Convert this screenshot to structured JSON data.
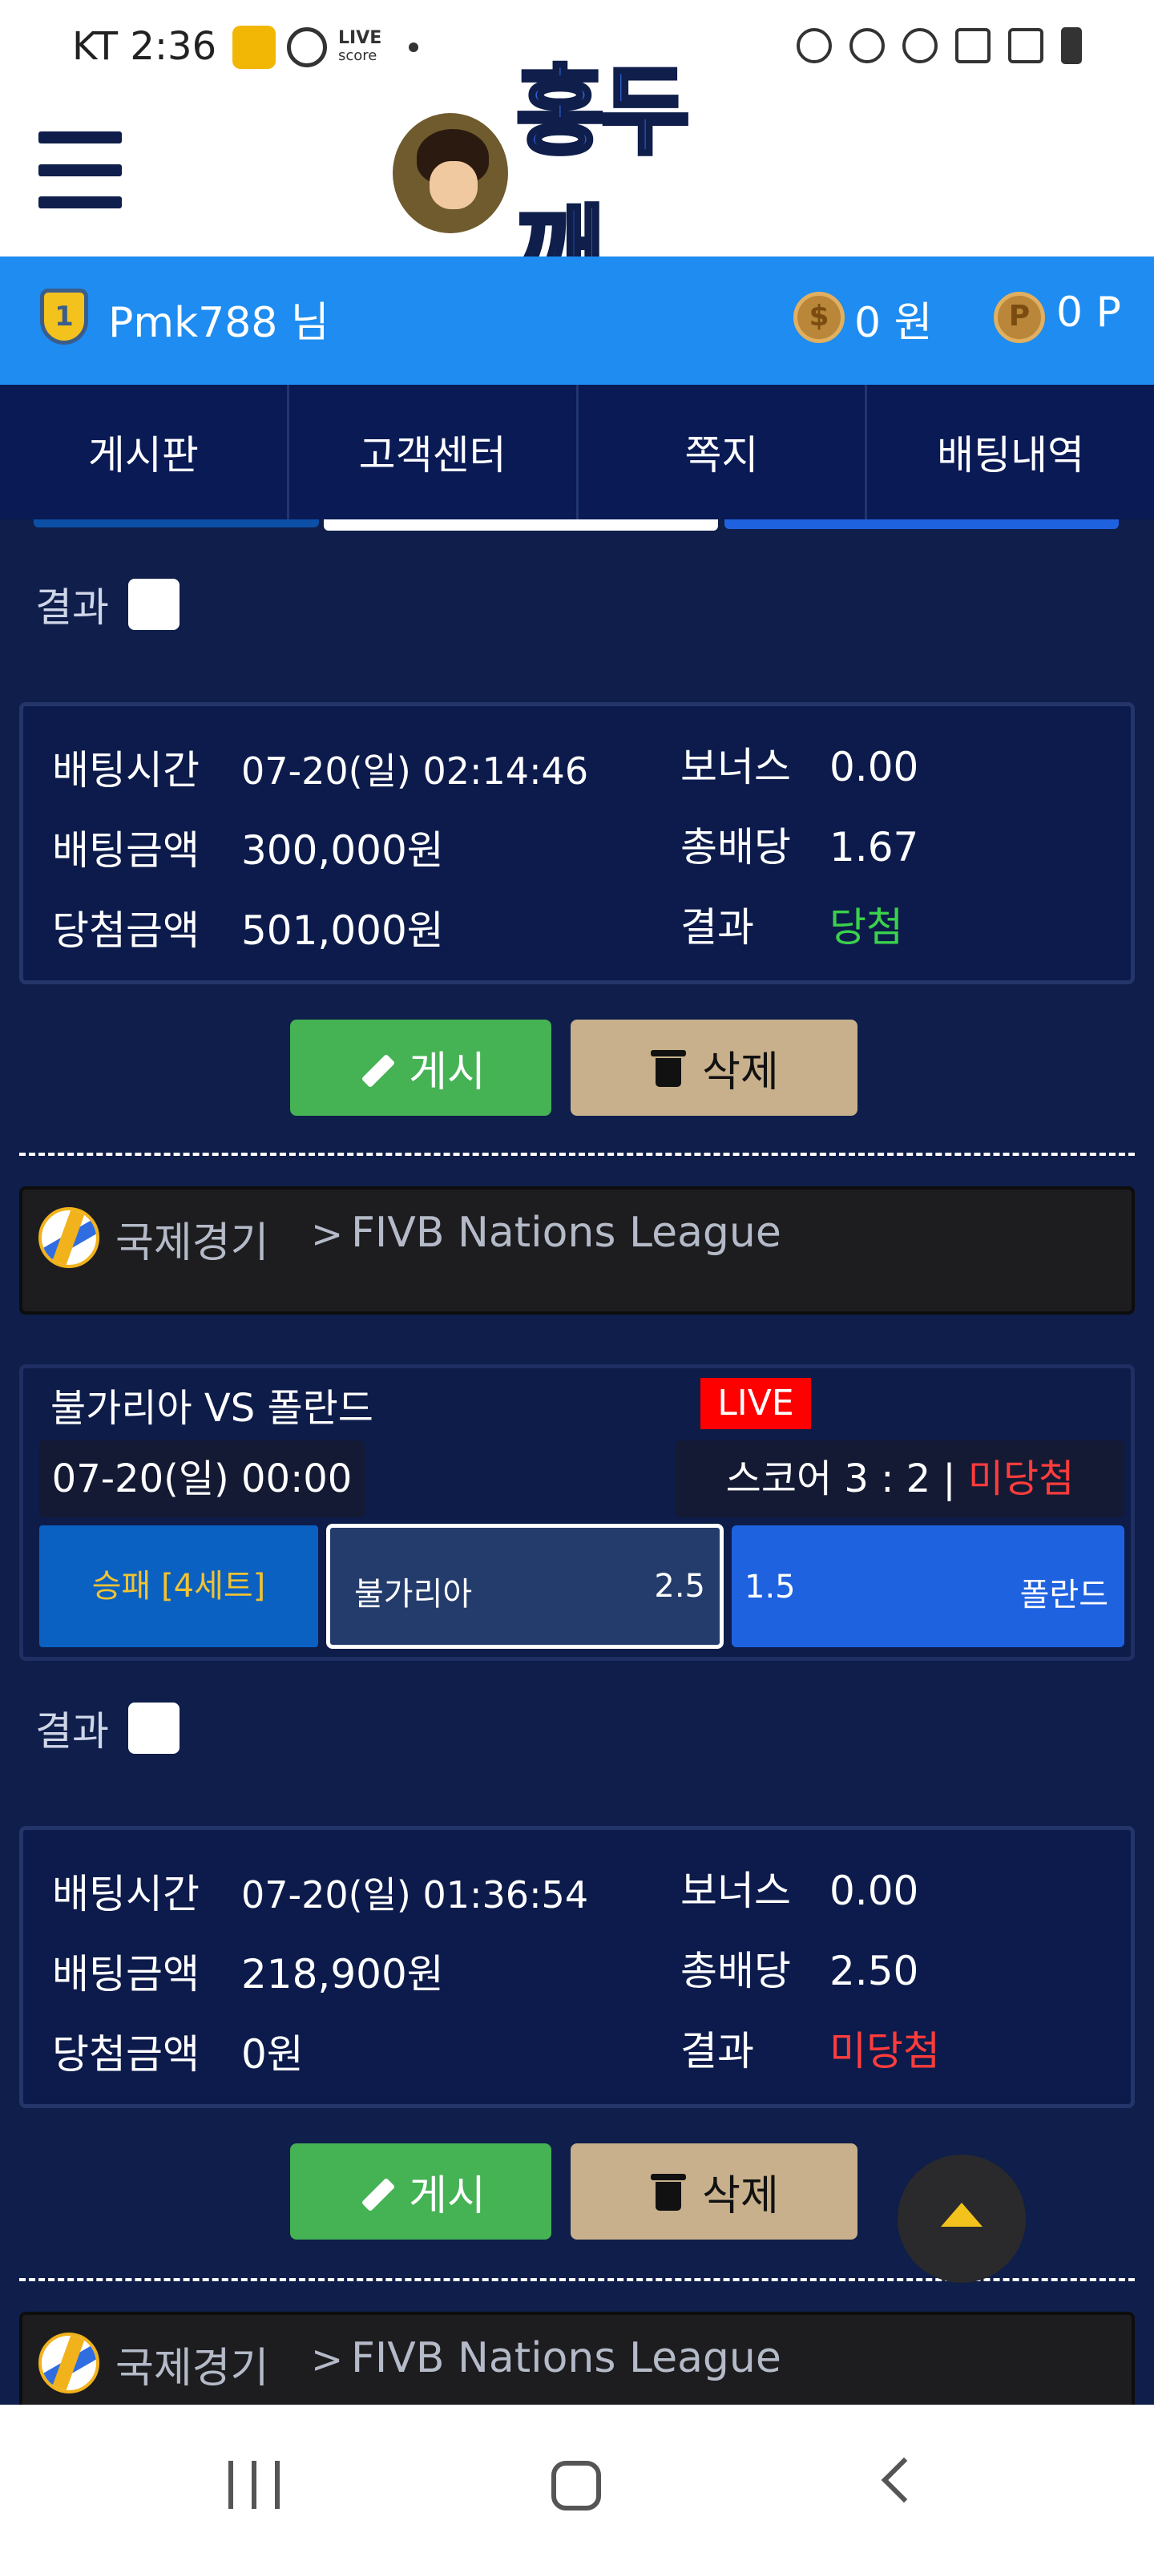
{
  "status_bar": {
    "time": "KT 2:36",
    "live_score_label": "LIVE",
    "live_score_sub": "score"
  },
  "header": {
    "logo_text": "홍두깨"
  },
  "user_bar": {
    "level": "1",
    "username": "Pmk788 님",
    "cash_symbol": "$",
    "cash": "0 원",
    "point_symbol": "P",
    "points": "0 P"
  },
  "nav": {
    "tabs": [
      "게시판",
      "고객센터",
      "쪽지",
      "배팅내역"
    ]
  },
  "bets": [
    {
      "result_label": "결과",
      "info": {
        "time_label": "배팅시간",
        "time": "07-20(일) 02:14:46",
        "amount_label": "배팅금액",
        "amount": "300,000원",
        "win_amount_label": "당첨금액",
        "win_amount": "501,000원",
        "bonus_label": "보너스",
        "bonus": "0.00",
        "total_odds_label": "총배당",
        "total_odds": "1.67",
        "result_label": "결과",
        "result": "당첨"
      },
      "post_label": "게시",
      "delete_label": "삭제"
    },
    {
      "league": {
        "category": "국제경기",
        "separator": ">",
        "name": "FIVB Nations League"
      },
      "match": {
        "teams": "불가리아 VS 폴란드",
        "live": "LIVE",
        "date": "07-20(일) 00:00",
        "score_prefix": "스코어 3 : 2 | ",
        "score_result": "미당첨",
        "market": "승패 [4세트]",
        "home_name": "불가리아",
        "home_odds": "2.5",
        "away_odds": "1.5",
        "away_name": "폴란드"
      },
      "result_label": "결과",
      "info": {
        "time_label": "배팅시간",
        "time": "07-20(일) 01:36:54",
        "amount_label": "배팅금액",
        "amount": "218,900원",
        "win_amount_label": "당첨금액",
        "win_amount": "0원",
        "bonus_label": "보너스",
        "bonus": "0.00",
        "total_odds_label": "총배당",
        "total_odds": "2.50",
        "result_label": "결과",
        "result": "미당첨"
      },
      "post_label": "게시",
      "delete_label": "삭제"
    },
    {
      "league": {
        "category": "국제경기",
        "separator": ">",
        "name": "FIVB Nations League"
      }
    }
  ],
  "colors": {
    "background": "#0f1e4a",
    "user_bar": "#1e8cf0",
    "nav": "#091a55",
    "win": "#3ad14c",
    "lose": "#ff3c3c",
    "post_button": "#45b254",
    "delete_button": "#c8b08c",
    "live_badge": "#ff0000"
  },
  "icons": [
    "hamburger-menu-icon",
    "level-shield-icon",
    "coin-icon",
    "point-icon",
    "pencil-icon",
    "trash-icon",
    "volleyball-icon",
    "scroll-top-icon"
  ]
}
